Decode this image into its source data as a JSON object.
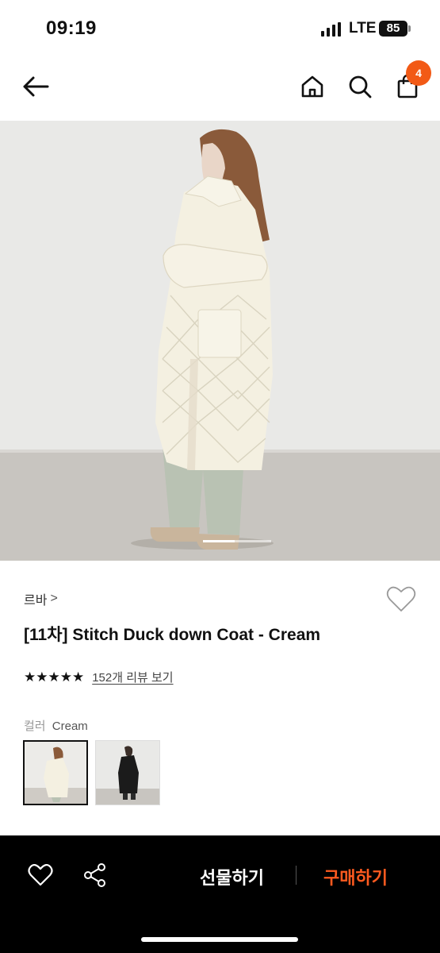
{
  "status_bar": {
    "time": "09:19",
    "network": "LTE",
    "battery": "85"
  },
  "nav": {
    "back_icon": "arrow-left-icon",
    "home_icon": "home-icon",
    "search_icon": "search-icon",
    "bag_icon": "shopping-bag-icon",
    "cart_count": "4",
    "accent_color": "#f25a16"
  },
  "product": {
    "brand": "르바",
    "brand_chevron": ">",
    "title": "[11차] Stitch Duck down Coat - Cream",
    "stars": "★★★★★",
    "rating_value": 5,
    "review_link": "152개 리뷰 보기",
    "color_label": "컬러",
    "color_value": "Cream",
    "swatches": [
      {
        "name": "Cream",
        "selected": true
      },
      {
        "name": "Black",
        "selected": false
      }
    ]
  },
  "bottom_bar": {
    "heart_icon": "heart-icon",
    "share_icon": "share-icon",
    "gift_label": "선물하기",
    "buy_label": "구매하기",
    "buy_color": "#ff5a1f"
  }
}
